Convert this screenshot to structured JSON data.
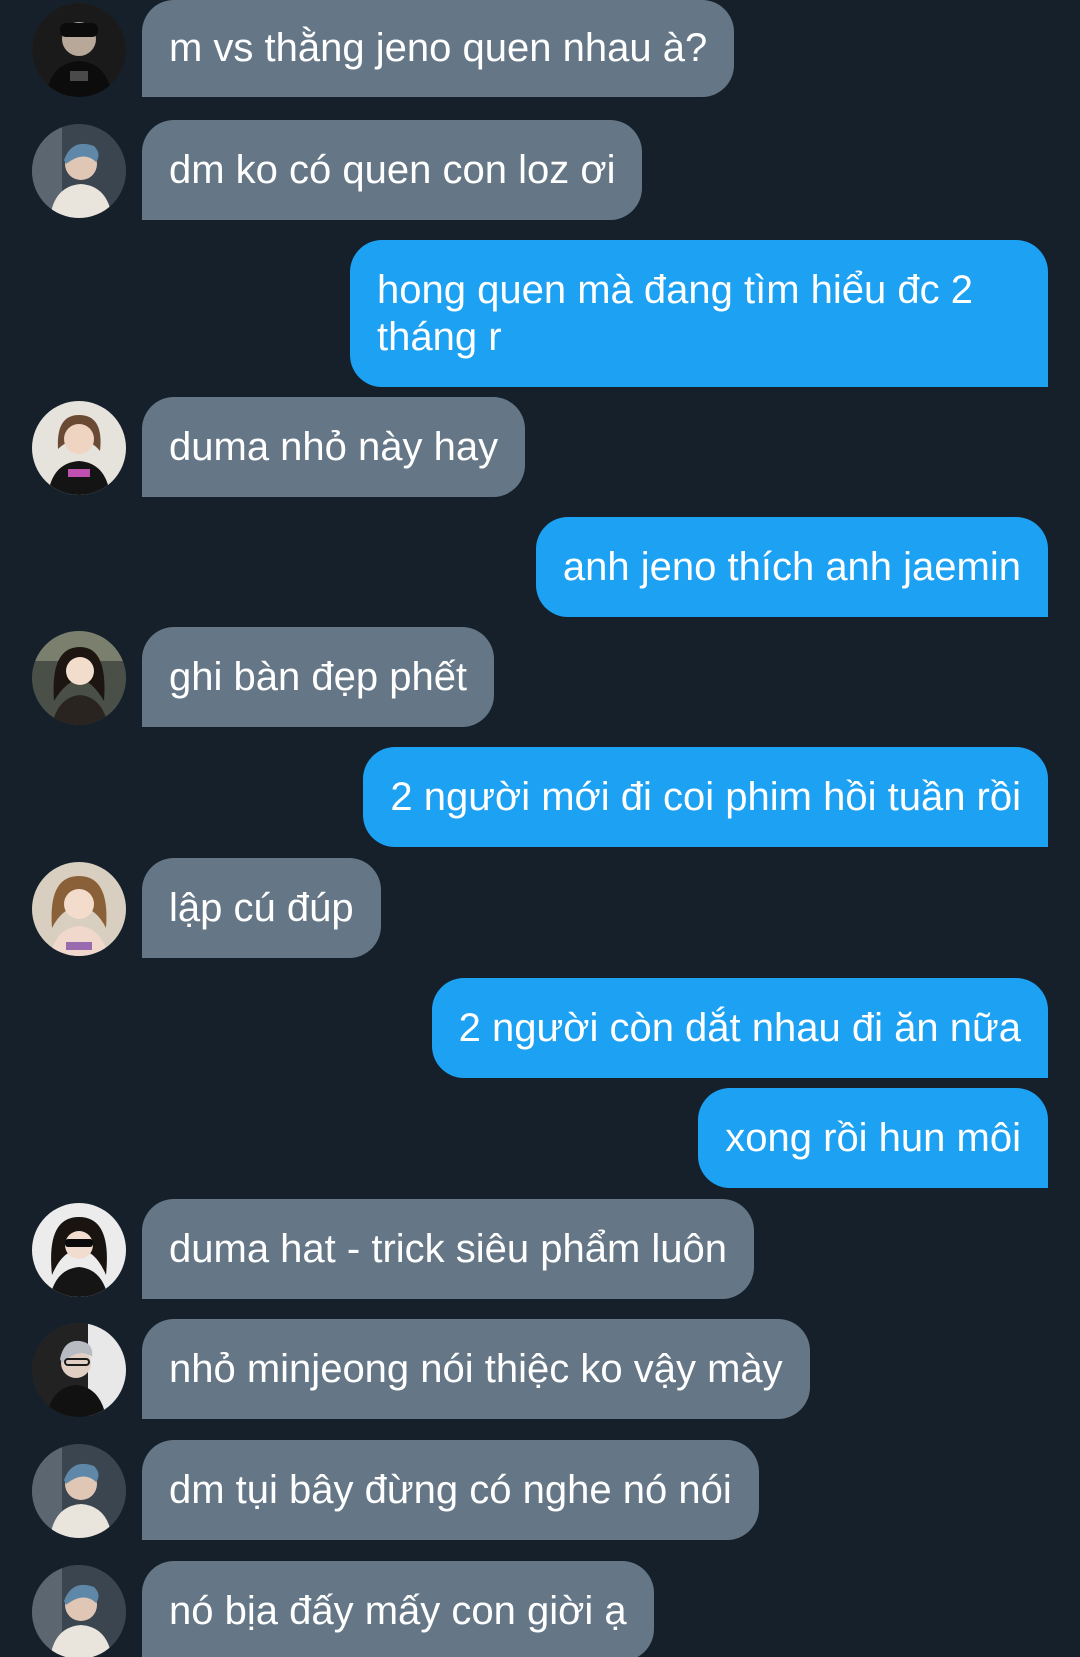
{
  "conversation": {
    "messages": [
      {
        "side": "in",
        "text": "m vs thằng jeno quen nhau à?",
        "avatar": "avatar-1"
      },
      {
        "side": "in",
        "text": "dm ko có quen con loz ơi",
        "avatar": "avatar-2"
      },
      {
        "side": "out",
        "text": "hong quen mà đang tìm hiểu đc 2 tháng r"
      },
      {
        "side": "in",
        "text": "duma nhỏ này hay",
        "avatar": "avatar-3"
      },
      {
        "side": "out",
        "text": "anh jeno thích anh jaemin"
      },
      {
        "side": "in",
        "text": "ghi bàn đẹp phết",
        "avatar": "avatar-4"
      },
      {
        "side": "out",
        "text": "2 người mới đi coi phim hồi tuần rồi"
      },
      {
        "side": "in",
        "text": "lập cú đúp",
        "avatar": "avatar-5"
      },
      {
        "side": "out",
        "text": "2 người còn dắt nhau đi ăn nữa"
      },
      {
        "side": "out",
        "text": "xong rồi hun môi"
      },
      {
        "side": "in",
        "text": "duma hat - trick siêu phẩm luôn",
        "avatar": "avatar-6"
      },
      {
        "side": "in",
        "text": "nhỏ minjeong nói thiệc ko vậy mày",
        "avatar": "avatar-7"
      },
      {
        "side": "in",
        "text": "dm tụi bây đừng có nghe nó nói",
        "avatar": "avatar-2"
      },
      {
        "side": "in",
        "text": "nó bịa đấy mấy con giời ạ",
        "avatar": "avatar-2"
      }
    ]
  },
  "colors": {
    "background": "#15202b",
    "incoming_bubble": "#657786",
    "outgoing_bubble": "#1da1f2",
    "text": "#ffffff"
  }
}
